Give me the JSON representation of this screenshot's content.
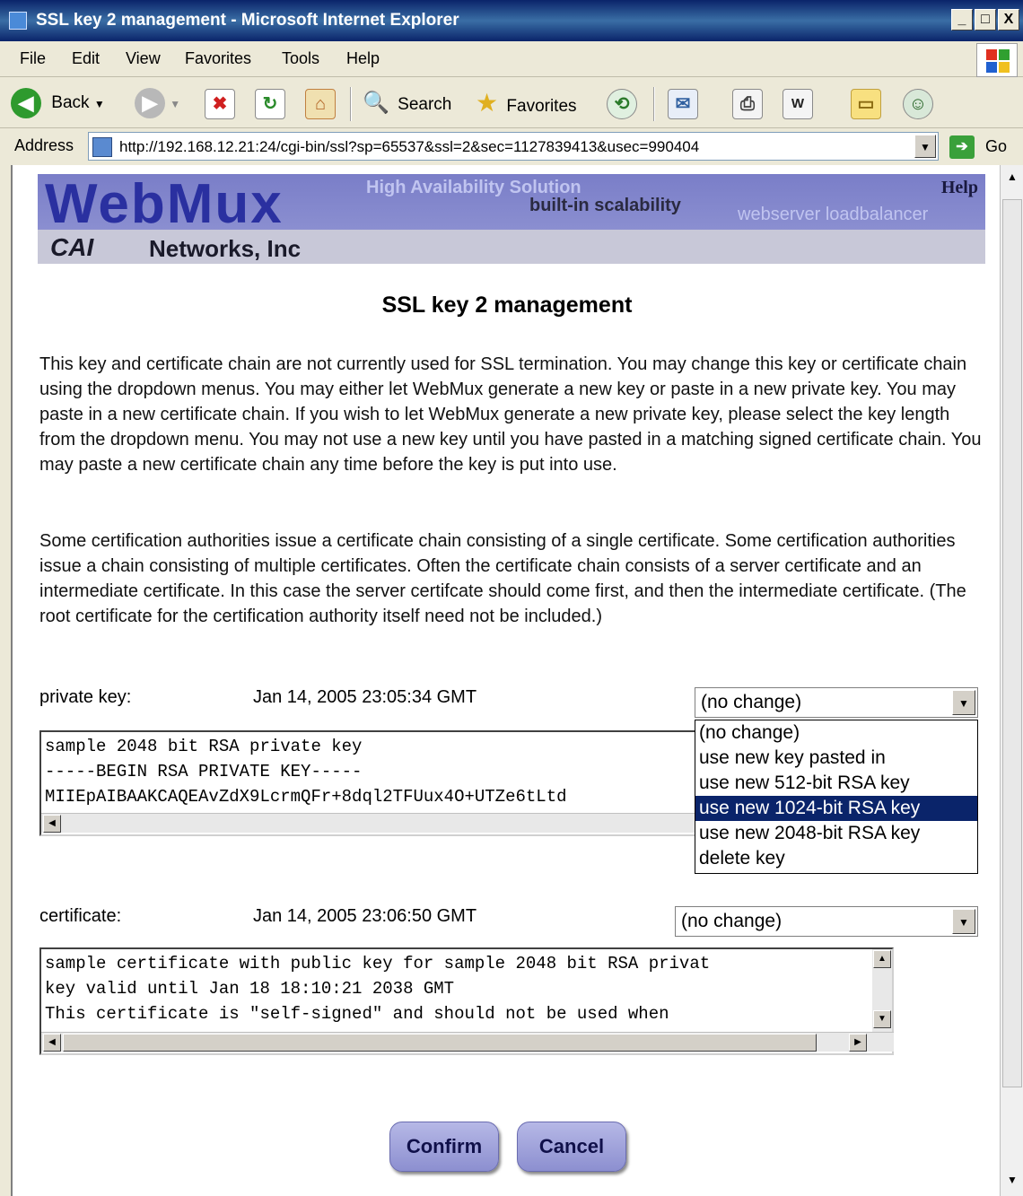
{
  "window": {
    "title": "SSL key 2 management - Microsoft Internet Explorer",
    "min_label": "_",
    "max_label": "□",
    "close_label": "X"
  },
  "menu": [
    "File",
    "Edit",
    "View",
    "Favorites",
    "Tools",
    "Help"
  ],
  "toolbar": {
    "back_label": "Back",
    "search_label": "Search",
    "favorites_label": "Favorites"
  },
  "address": {
    "label": "Address",
    "url": "http://192.168.12.21:24/cgi-bin/ssl?sp=65537&ssl=2&sec=1127839413&usec=990404",
    "go_label": "Go"
  },
  "banner": {
    "logo": "WebMux",
    "tagline": "High Availability Solution",
    "subtag": "built-in scalability",
    "subtag2": "webserver loadbalancer",
    "help": "Help",
    "company_logo": "CAI",
    "company": "Networks, Inc"
  },
  "page": {
    "title": "SSL key 2 management",
    "para1": "This key and certificate chain are not currently used for SSL termination. You may change this key or certificate chain using the dropdown menus. You may either let WebMux generate a new key or paste in a new private key. You may paste in a new certificate chain. If you wish to let WebMux generate a new private key, please select the key length from the dropdown menu. You may not use a new key until you have pasted in a matching signed certificate chain. You may paste a new certificate chain any time before the key is put into use.",
    "para2": "Some certification authorities issue a certificate chain consisting of a single certificate. Some certification authorities issue a chain consisting of multiple certificates. Often the certificate chain consists of a server certificate and an intermediate certificate. In this case the server certifcate should come first, and then the intermediate certificate. (The root certificate for the certification authority itself need not be included.)"
  },
  "private_key": {
    "label": "private key:",
    "date": "Jan 14, 2005 23:05:34 GMT",
    "selected": "(no change)",
    "text": "sample 2048 bit RSA private key\n-----BEGIN RSA PRIVATE KEY-----\nMIIEpAIBAAKCAQEAvZdX9LcrmQFr+8dql2TFUux4O+UTZe6tLtd",
    "options": [
      "(no change)",
      "use new key pasted in",
      "use new 512-bit RSA key",
      "use new 1024-bit RSA key",
      "use new 2048-bit RSA key",
      "delete key"
    ],
    "highlighted_option": "use new 1024-bit RSA key"
  },
  "certificate": {
    "label": "certificate:",
    "date": "Jan 14, 2005 23:06:50 GMT",
    "selected": "(no change)",
    "text": "sample certificate with public key for sample 2048 bit RSA privat\nkey valid until Jan 18 18:10:21 2038 GMT\nThis certificate is \"self-signed\" and should not be used when"
  },
  "buttons": {
    "confirm": "Confirm",
    "cancel": "Cancel"
  }
}
